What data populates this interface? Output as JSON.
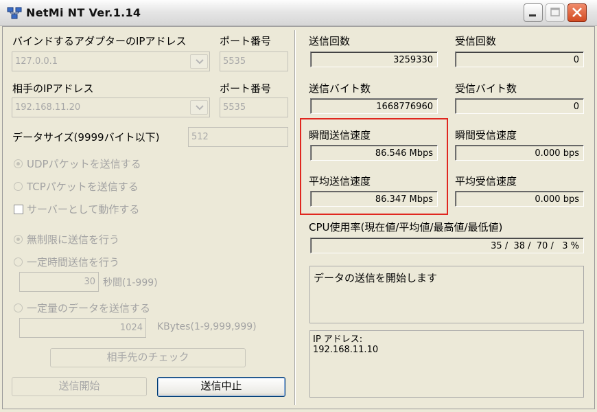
{
  "window": {
    "title": "NetMi NT Ver.1.14"
  },
  "left": {
    "bind_adapter_label": "バインドするアダプターのIPアドレス",
    "bind_port_label": "ポート番号",
    "bind_ip_value": "127.0.0.1",
    "bind_port_value": "5535",
    "remote_ip_label": "相手のIPアドレス",
    "remote_port_label": "ポート番号",
    "remote_ip_value": "192.168.11.20",
    "remote_port_value": "5535",
    "data_size_label": "データサイズ(9999バイト以下)",
    "data_size_value": "512",
    "udp_label": "UDPパケットを送信する",
    "tcp_label": "TCPパケットを送信する",
    "server_label": "サーバーとして動作する",
    "unlimited_label": "無制限に送信を行う",
    "timed_label": "一定時間送信を行う",
    "seconds_value": "30",
    "seconds_unit": "秒間(1-999)",
    "amount_label": "一定量のデータを送信する",
    "kbytes_value": "1024",
    "kbytes_unit": "KBytes(1-9,999,999)",
    "check_button": "相手先のチェック",
    "start_button": "送信開始",
    "stop_button": "送信中止"
  },
  "right": {
    "send_count_label": "送信回数",
    "send_count_value": "3259330",
    "recv_count_label": "受信回数",
    "recv_count_value": "0",
    "send_bytes_label": "送信バイト数",
    "send_bytes_value": "1668776960",
    "recv_bytes_label": "受信バイト数",
    "recv_bytes_value": "0",
    "inst_send_label": "瞬間送信速度",
    "inst_send_value": "86.546 Mbps",
    "inst_recv_label": "瞬間受信速度",
    "inst_recv_value": "0.000 bps",
    "avg_send_label": "平均送信速度",
    "avg_send_value": "86.347 Mbps",
    "avg_recv_label": "平均受信速度",
    "avg_recv_value": "0.000 bps",
    "cpu_label": "CPU使用率(現在値/平均値/最高値/最低値)",
    "cpu_value": "35 /  38 /  70 /   3 %",
    "message": "データの送信を開始します",
    "ip_info_line1": "IP アドレス:",
    "ip_info_line2": "192.168.11.10"
  },
  "colors": {
    "highlight": "#e0271f",
    "close_button": "#d24b22",
    "background": "#ece9d8"
  }
}
